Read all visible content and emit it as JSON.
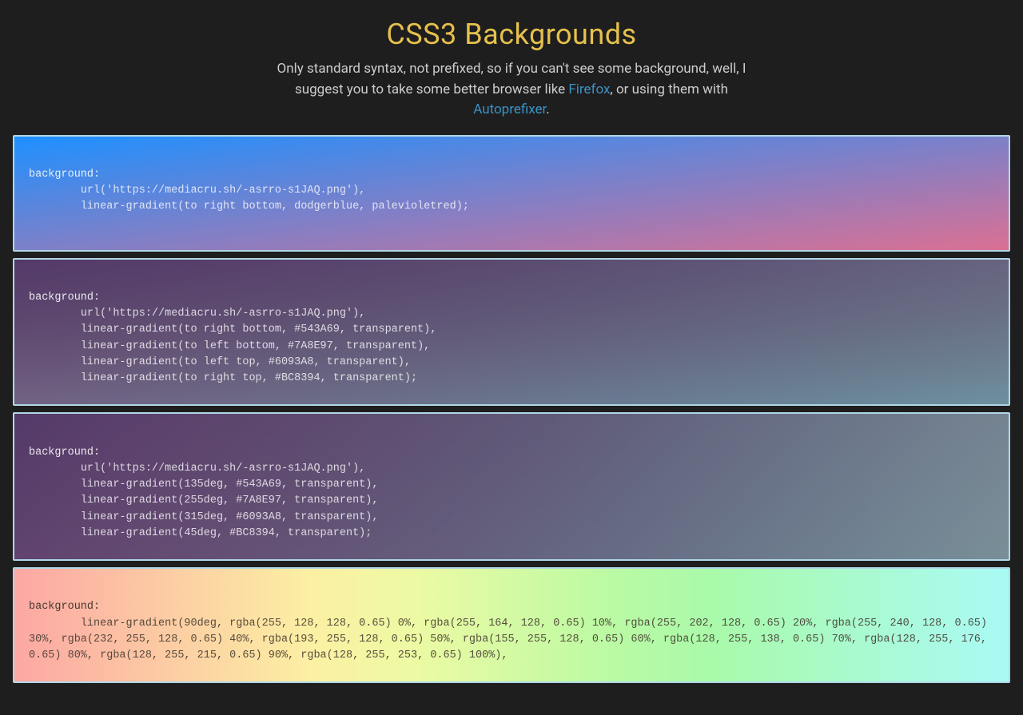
{
  "header": {
    "title": "CSS3 Backgrounds",
    "subtitle_prefix": "Only standard syntax, not prefixed, so if you can't see some background, well, I suggest you to take some better browser like ",
    "link1_text": "Firefox",
    "subtitle_mid": ", or using them with ",
    "link2_text": "Autoprefixer",
    "subtitle_suffix": "."
  },
  "examples": [
    {
      "id": "ex1",
      "code_first": "background:",
      "code_rest": "        url('https://mediacru.sh/-asrro-s1JAQ.png'),\n        linear-gradient(to right bottom, dodgerblue, palevioletred);"
    },
    {
      "id": "ex2",
      "code_first": "background:",
      "code_rest": "        url('https://mediacru.sh/-asrro-s1JAQ.png'),\n        linear-gradient(to right bottom, #543A69, transparent),\n        linear-gradient(to left bottom, #7A8E97, transparent),\n        linear-gradient(to left top, #6093A8, transparent),\n        linear-gradient(to right top, #BC8394, transparent);"
    },
    {
      "id": "ex3",
      "code_first": "background:",
      "code_rest": "        url('https://mediacru.sh/-asrro-s1JAQ.png'),\n        linear-gradient(135deg, #543A69, transparent),\n        linear-gradient(255deg, #7A8E97, transparent),\n        linear-gradient(315deg, #6093A8, transparent),\n        linear-gradient(45deg, #BC8394, transparent);"
    },
    {
      "id": "ex4",
      "code_first": "background:",
      "code_rest": "        linear-gradient(90deg, rgba(255, 128, 128, 0.65) 0%, rgba(255, 164, 128, 0.65) 10%, rgba(255, 202, 128, 0.65) 20%, rgba(255, 240, 128, 0.65) 30%, rgba(232, 255, 128, 0.65) 40%, rgba(193, 255, 128, 0.65) 50%, rgba(155, 255, 128, 0.65) 60%, rgba(128, 255, 138, 0.65) 70%, rgba(128, 255, 176, 0.65) 80%, rgba(128, 255, 215, 0.65) 90%, rgba(128, 255, 253, 0.65) 100%),"
    }
  ]
}
